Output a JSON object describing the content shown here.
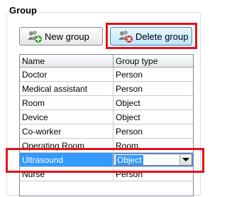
{
  "group": {
    "title": "Group",
    "new_button_label": "New group",
    "delete_button_label": "Delete group"
  },
  "grid": {
    "columns": [
      "Name",
      "Group type"
    ],
    "rows": [
      {
        "name": "Doctor",
        "type": "Person"
      },
      {
        "name": "Medical assistant",
        "type": "Person"
      },
      {
        "name": "Room",
        "type": "Object"
      },
      {
        "name": "Device",
        "type": "Object"
      },
      {
        "name": "Co-worker",
        "type": "Person"
      },
      {
        "name": "Operating Room",
        "type": "Room"
      },
      {
        "name": "Ultrasound",
        "type": "Object"
      },
      {
        "name": "Nurse",
        "type": "Person"
      }
    ],
    "selected_row": 6
  },
  "colors": {
    "highlight": "#e3131b",
    "selection": "#3399ff"
  },
  "icons": {
    "new_group": "users-add-icon",
    "delete_group": "users-delete-icon",
    "dropdown": "chevron-down-icon"
  }
}
